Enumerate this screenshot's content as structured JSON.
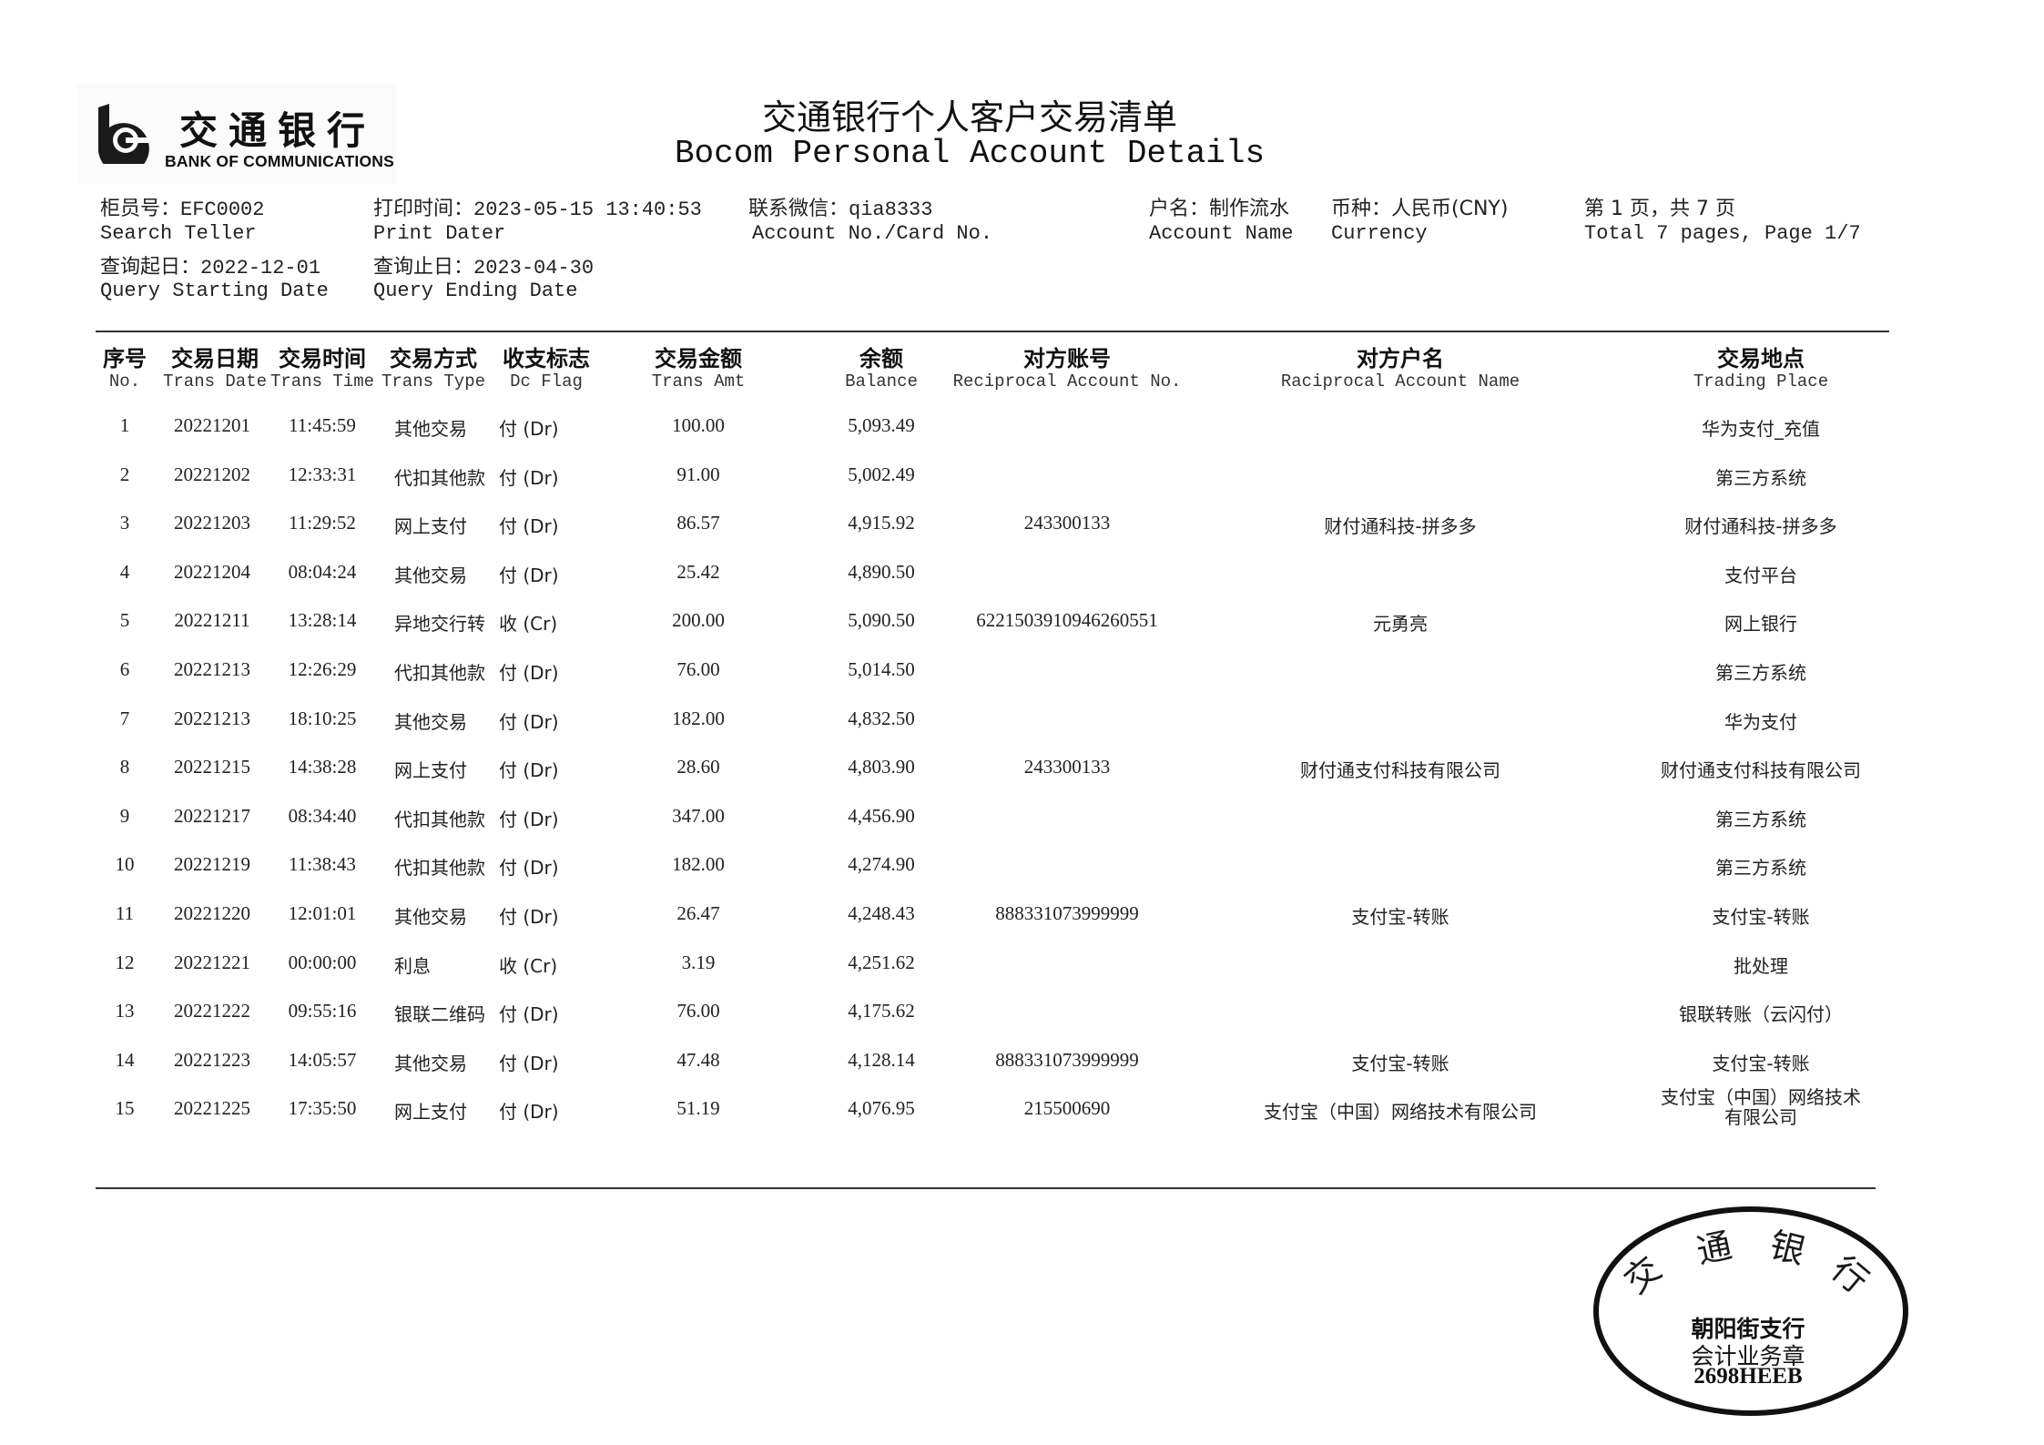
{
  "logo": {
    "cn": "交通银行",
    "en": "BANK OF COMMUNICATIONS"
  },
  "title": {
    "cn": "交通银行个人客户交易清单",
    "en": "Bocom Personal Account Details"
  },
  "meta": {
    "teller_label_cn": "柜员号：",
    "teller_value": "EFC0002",
    "teller_label_en": "Search Teller",
    "print_label_cn": "打印时间：",
    "print_value": "2023-05-15 13:40:53",
    "print_label_en": "Print Dater",
    "wechat_label_cn": "联系微信：",
    "wechat_value": "qia8333",
    "account_no_label_en": "Account No./Card No.",
    "account_name_label_cn": "户名：",
    "account_name_value": "制作流水",
    "account_name_label_en": "Account Name",
    "currency_label_cn": "币种：",
    "currency_value": "人民币(CNY)",
    "currency_label_en": "Currency",
    "page_cn": "第 1 页，共  7  页",
    "page_en": "Total  7  pages, Page 1/7",
    "start_label_cn": "查询起日：",
    "start_value": "2022-12-01",
    "start_label_en": "Query Starting Date",
    "end_label_cn": "查询止日：",
    "end_value": "2023-04-30",
    "end_label_en": "Query Ending Date"
  },
  "table": {
    "columns": [
      {
        "cn": "序号",
        "en": "No."
      },
      {
        "cn": "交易日期",
        "en": "Trans Date"
      },
      {
        "cn": "交易时间",
        "en": "Trans Time"
      },
      {
        "cn": "交易方式",
        "en": "Trans Type"
      },
      {
        "cn": "收支标志",
        "en": "Dc Flag"
      },
      {
        "cn": "交易金额",
        "en": "Trans Amt"
      },
      {
        "cn": "余额",
        "en": "Balance"
      },
      {
        "cn": "对方账号",
        "en": "Reciprocal Account No."
      },
      {
        "cn": "对方户名",
        "en": "Raciprocal Account Name"
      },
      {
        "cn": "交易地点",
        "en": "Trading Place"
      }
    ],
    "rows": [
      {
        "no": "1",
        "date": "20221201",
        "time": "11:45:59",
        "type": "其他交易",
        "flag": "付 (Dr)",
        "amt": "100.00",
        "bal": "5,093.49",
        "acct": "",
        "name": "",
        "place": "华为支付_充值"
      },
      {
        "no": "2",
        "date": "20221202",
        "time": "12:33:31",
        "type": "代扣其他款",
        "flag": "付 (Dr)",
        "amt": "91.00",
        "bal": "5,002.49",
        "acct": "",
        "name": "",
        "place": "第三方系统"
      },
      {
        "no": "3",
        "date": "20221203",
        "time": "11:29:52",
        "type": "网上支付",
        "flag": "付 (Dr)",
        "amt": "86.57",
        "bal": "4,915.92",
        "acct": "243300133",
        "name": "财付通科技-拼多多",
        "place": "财付通科技-拼多多"
      },
      {
        "no": "4",
        "date": "20221204",
        "time": "08:04:24",
        "type": "其他交易",
        "flag": "付 (Dr)",
        "amt": "25.42",
        "bal": "4,890.50",
        "acct": "",
        "name": "",
        "place": "支付平台"
      },
      {
        "no": "5",
        "date": "20221211",
        "time": "13:28:14",
        "type": "异地交行转",
        "flag": "收 (Cr)",
        "amt": "200.00",
        "bal": "5,090.50",
        "acct": "6221503910946260551",
        "name": "元勇亮",
        "place": "网上银行"
      },
      {
        "no": "6",
        "date": "20221213",
        "time": "12:26:29",
        "type": "代扣其他款",
        "flag": "付 (Dr)",
        "amt": "76.00",
        "bal": "5,014.50",
        "acct": "",
        "name": "",
        "place": "第三方系统"
      },
      {
        "no": "7",
        "date": "20221213",
        "time": "18:10:25",
        "type": "其他交易",
        "flag": "付 (Dr)",
        "amt": "182.00",
        "bal": "4,832.50",
        "acct": "",
        "name": "",
        "place": "华为支付"
      },
      {
        "no": "8",
        "date": "20221215",
        "time": "14:38:28",
        "type": "网上支付",
        "flag": "付 (Dr)",
        "amt": "28.60",
        "bal": "4,803.90",
        "acct": "243300133",
        "name": "财付通支付科技有限公司",
        "place": "财付通支付科技有限公司"
      },
      {
        "no": "9",
        "date": "20221217",
        "time": "08:34:40",
        "type": "代扣其他款",
        "flag": "付 (Dr)",
        "amt": "347.00",
        "bal": "4,456.90",
        "acct": "",
        "name": "",
        "place": "第三方系统"
      },
      {
        "no": "10",
        "date": "20221219",
        "time": "11:38:43",
        "type": "代扣其他款",
        "flag": "付 (Dr)",
        "amt": "182.00",
        "bal": "4,274.90",
        "acct": "",
        "name": "",
        "place": "第三方系统"
      },
      {
        "no": "11",
        "date": "20221220",
        "time": "12:01:01",
        "type": "其他交易",
        "flag": "付 (Dr)",
        "amt": "26.47",
        "bal": "4,248.43",
        "acct": "888331073999999",
        "name": "支付宝-转账",
        "place": "支付宝-转账"
      },
      {
        "no": "12",
        "date": "20221221",
        "time": "00:00:00",
        "type": "利息",
        "flag": "收 (Cr)",
        "amt": "3.19",
        "bal": "4,251.62",
        "acct": "",
        "name": "",
        "place": "批处理"
      },
      {
        "no": "13",
        "date": "20221222",
        "time": "09:55:16",
        "type": "银联二维码",
        "flag": "付 (Dr)",
        "amt": "76.00",
        "bal": "4,175.62",
        "acct": "",
        "name": "",
        "place": "银联转账（云闪付）"
      },
      {
        "no": "14",
        "date": "20221223",
        "time": "14:05:57",
        "type": "其他交易",
        "flag": "付 (Dr)",
        "amt": "47.48",
        "bal": "4,128.14",
        "acct": "888331073999999",
        "name": "支付宝-转账",
        "place": "支付宝-转账"
      },
      {
        "no": "15",
        "date": "20221225",
        "time": "17:35:50",
        "type": "网上支付",
        "flag": "付 (Dr)",
        "amt": "51.19",
        "bal": "4,076.95",
        "acct": "215500690",
        "name": "支付宝（中国）网络技术有限公司",
        "place": "支付宝（中国）网络技术\n有限公司"
      }
    ]
  },
  "stamp": {
    "arc_text": [
      "交",
      "通",
      "银",
      "行"
    ],
    "branch": "朝阳街支行",
    "purpose": "会计业务章",
    "code": "2698HEEB"
  }
}
